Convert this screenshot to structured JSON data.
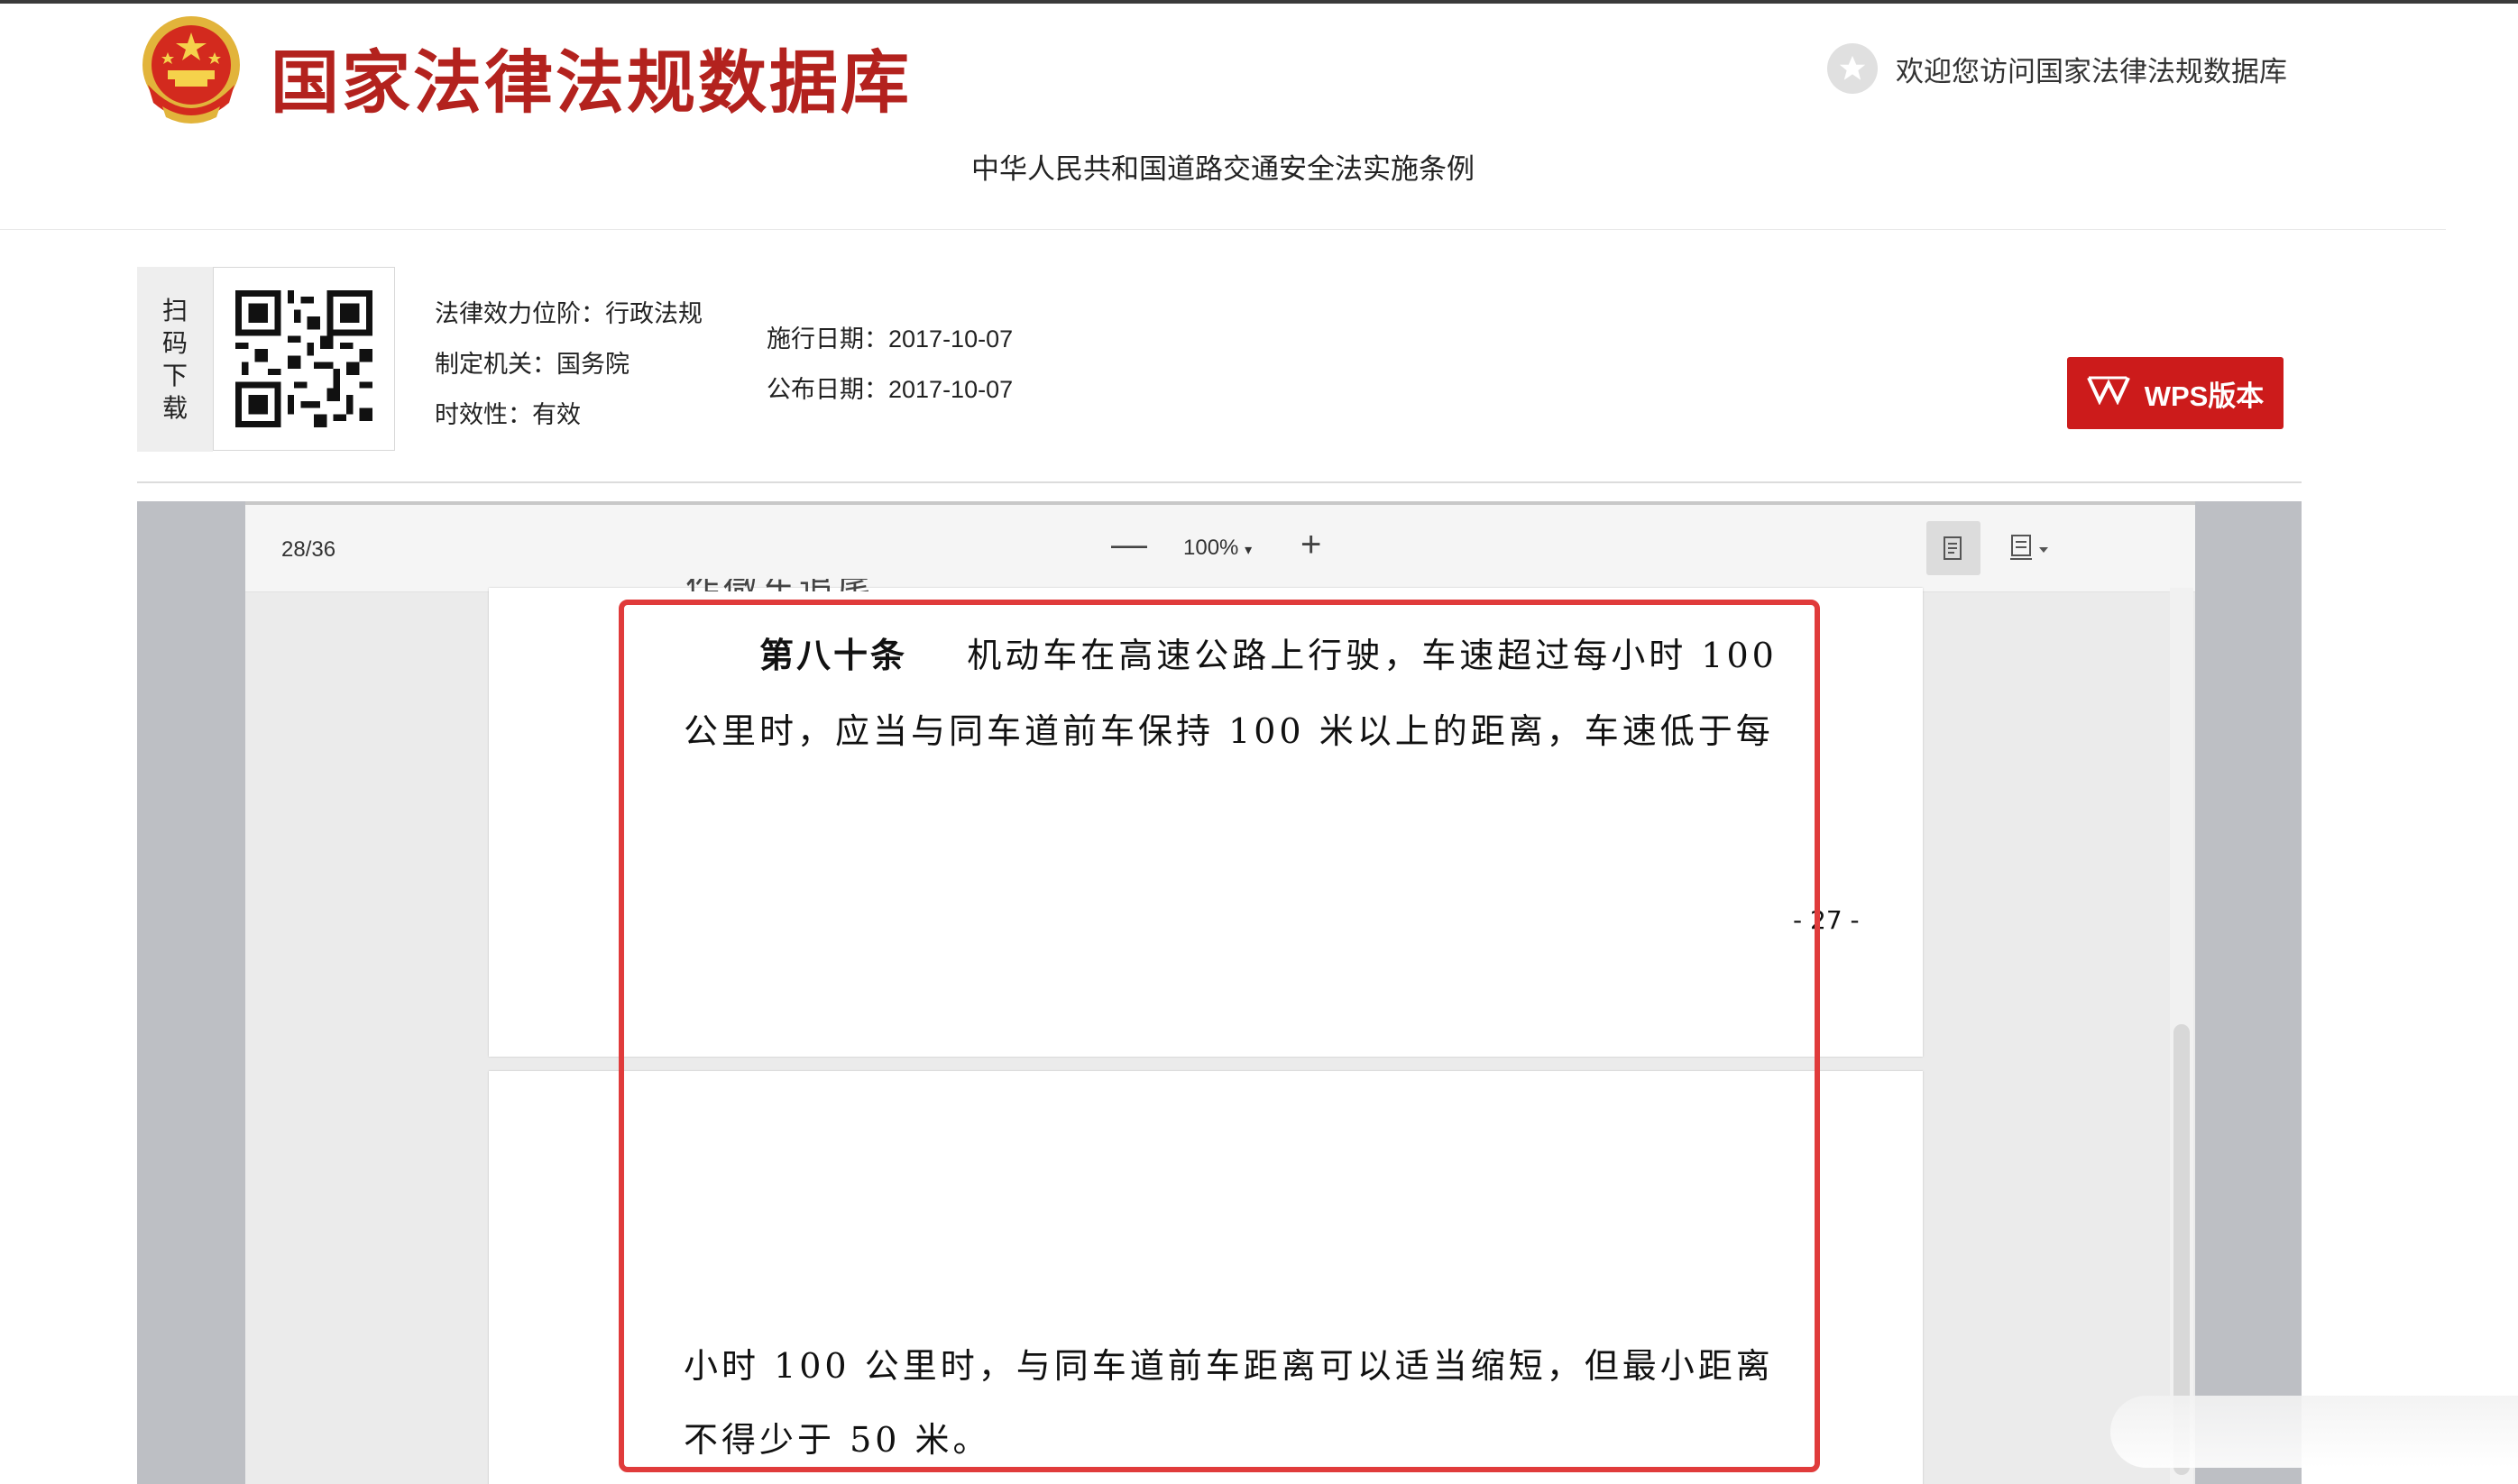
{
  "header": {
    "site_title": "国家法律法规数据库",
    "welcome_text": "欢迎您访问国家法律法规数据库",
    "document_title": "中华人民共和国道路交通安全法实施条例"
  },
  "info": {
    "scan_label": [
      "扫",
      "码",
      "下",
      "载"
    ],
    "legal_effect": "法律效力位阶：行政法规",
    "issuing_authority": "制定机关：国务院",
    "validity": "时效性：有效",
    "effective_date": "施行日期：2017-10-07",
    "publish_date": "公布日期：2017-10-07",
    "wps_button": "WPS版本"
  },
  "viewer": {
    "page_indicator": "28/36",
    "zoom_level": "100%",
    "zoom_out_symbol": "—",
    "zoom_in_symbol": "+",
    "top_clipped_text": "作微车追尾...",
    "article_title": "第八十条",
    "line1_rest": "机动车在高速公路上行驶，车速超过每小时 100",
    "line2": "公里时，应当与同车道前车保持 100 米以上的距离，车速低于每",
    "page_number": "- 27 -",
    "line3": "小时 100 公里时，与同车道前车距离可以适当缩短，但最小距离",
    "line4": "不得少于 50 米。"
  },
  "colors": {
    "brand_red": "#b3221e",
    "wps_red": "#cc1b1b",
    "highlight_red": "#e03b3b"
  },
  "icons": [
    "national-emblem-icon",
    "star-icon",
    "qr-code-icon",
    "wps-icon",
    "read-mode-icon",
    "display-mode-icon"
  ]
}
